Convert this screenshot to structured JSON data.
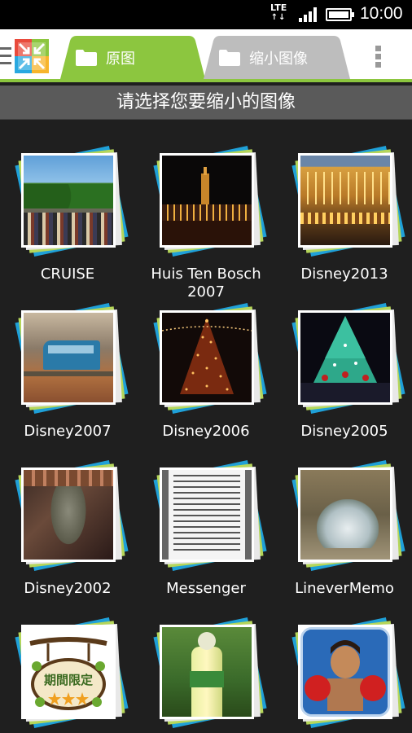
{
  "status_bar": {
    "network": "LTE",
    "time": "10:00"
  },
  "tabs": [
    {
      "label": "原图",
      "active": true,
      "color": "#8cc63f"
    },
    {
      "label": "缩小图像",
      "active": false,
      "color": "#bdbdbd"
    }
  ],
  "prompt": "请选择您要缩小的图像",
  "albums": [
    {
      "name": "CRUISE",
      "thumb": "street-crowd-trees"
    },
    {
      "name": "Huis Ten Bosch 2007",
      "thumb": "night-tower-lights"
    },
    {
      "name": "Disney2013",
      "thumb": "lit-building-night"
    },
    {
      "name": "Disney2007",
      "thumb": "monorail-train"
    },
    {
      "name": "Disney2006",
      "thumb": "christmas-tree-lights"
    },
    {
      "name": "Disney2005",
      "thumb": "christmas-tree-stage"
    },
    {
      "name": "Disney2002",
      "thumb": "bronze-statue"
    },
    {
      "name": "Messenger",
      "thumb": "document-text"
    },
    {
      "name": "LineverMemo",
      "thumb": "glass-cup"
    },
    {
      "name": "",
      "thumb": "limited-sign"
    },
    {
      "name": "",
      "thumb": "bottle-drinks"
    },
    {
      "name": "",
      "thumb": "boxer-game-icon"
    }
  ],
  "icons": {
    "menu": "hamburger-icon",
    "logo": "shrink-arrows-logo",
    "tab_folder": "folder-icon",
    "overflow": "overflow-menu-icon"
  },
  "sign_text": "期間限定"
}
